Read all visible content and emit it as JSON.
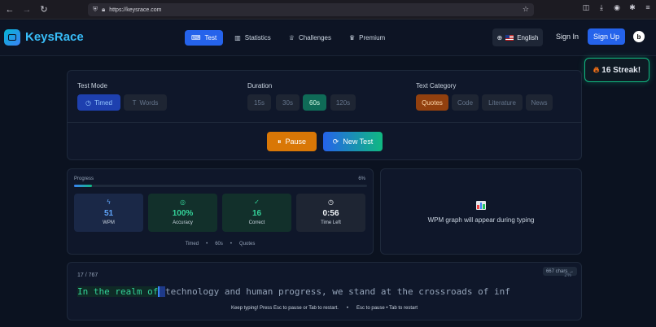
{
  "browser": {
    "url": "https://keysrace.com"
  },
  "header": {
    "brand": "KeysRace",
    "nav": [
      {
        "label": "Test",
        "icon": "keyboard-icon"
      },
      {
        "label": "Statistics",
        "icon": "bar-chart-icon"
      },
      {
        "label": "Challenges",
        "icon": "trophy-icon"
      },
      {
        "label": "Premium",
        "icon": "crown-icon"
      }
    ],
    "language": "English",
    "sign_in": "Sign In",
    "sign_up": "Sign Up",
    "avatar_letter": "b"
  },
  "streak": {
    "label": "16 Streak!"
  },
  "settings": {
    "test_mode_title": "Test Mode",
    "modes": [
      "Timed",
      "Words"
    ],
    "duration_title": "Duration",
    "durations": [
      "15s",
      "30s",
      "60s",
      "120s"
    ],
    "category_title": "Text Category",
    "categories": [
      "Quotes",
      "Code",
      "Literature",
      "News"
    ],
    "pause_label": "Pause",
    "new_test_label": "New Test"
  },
  "progress": {
    "label": "Progress",
    "percent_text": "6%",
    "percent": 6
  },
  "stats": [
    {
      "value": "51",
      "label": "WPM"
    },
    {
      "value": "100%",
      "label": "Accuracy"
    },
    {
      "value": "16",
      "label": "Correct"
    },
    {
      "value": "0:56",
      "label": "Time Left"
    }
  ],
  "meta": [
    "Timed",
    "60s",
    "Quotes"
  ],
  "graph": {
    "placeholder": "WPM graph will appear during typing"
  },
  "typing": {
    "count": "17 / 767",
    "chars_tag": "667 chars →",
    "mini_pct": "2%",
    "typed": "In the realm of",
    "cursor_char": " ",
    "remaining": "technology and human progress, we stand at the crossroads of inf",
    "hint_1": "Keep typing! Press Esc to pause or Tab to restart.",
    "hint_2": "Esc to pause • Tab to restart"
  }
}
